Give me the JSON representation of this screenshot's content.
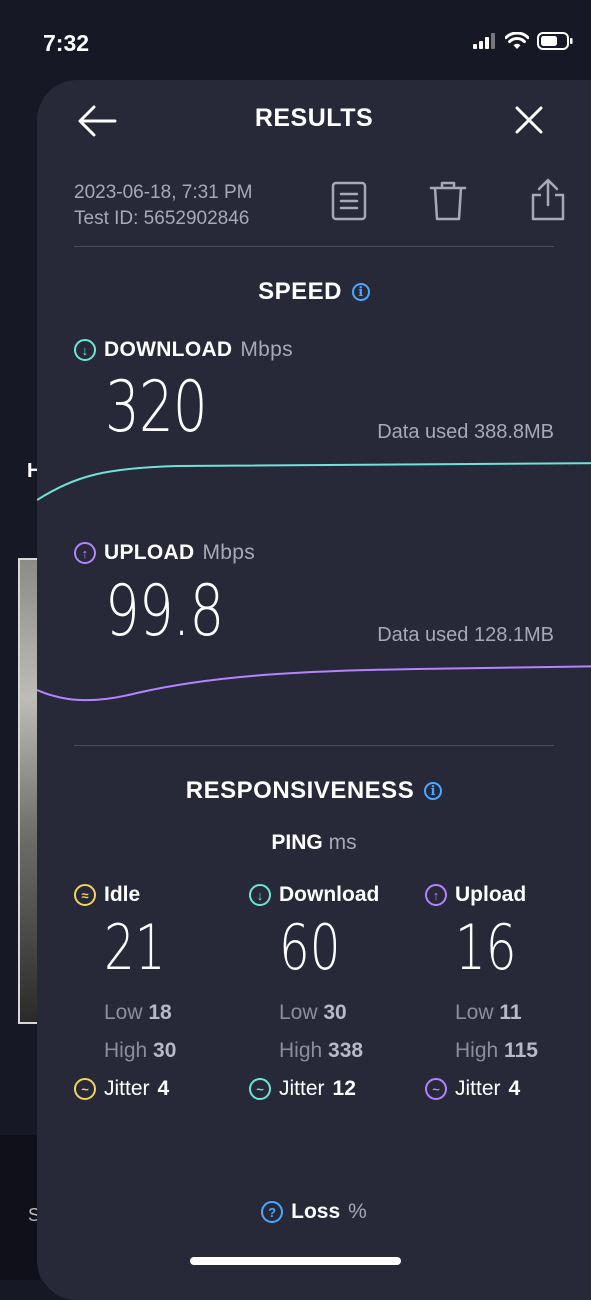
{
  "status_bar": {
    "time": "7:32"
  },
  "background": {
    "letter_top": "H",
    "letter_bottom": "S"
  },
  "header": {
    "title": "RESULTS"
  },
  "meta": {
    "date": "2023-06-18, 7:31 PM",
    "test_id": "Test ID: 5652902846"
  },
  "toolbar": {
    "icons": [
      "document-icon",
      "trash-icon",
      "share-icon"
    ]
  },
  "speed": {
    "title": "SPEED",
    "download": {
      "label": "DOWNLOAD",
      "unit": "Mbps",
      "value": "320",
      "data_used": "Data used 388.8MB",
      "color": "#6fe3d6"
    },
    "upload": {
      "label": "UPLOAD",
      "unit": "Mbps",
      "value": "99.8",
      "data_used": "Data used 128.1MB",
      "color": "#b583ff"
    }
  },
  "responsiveness": {
    "title": "RESPONSIVENESS",
    "ping_label": "PING",
    "ping_unit": "ms",
    "columns": [
      {
        "label": "Idle",
        "value": "21",
        "low_label": "Low",
        "low": "18",
        "high_label": "High",
        "high": "30",
        "jitter_label": "Jitter",
        "jitter": "4",
        "color": "#f2d35b",
        "icon": "idle-icon"
      },
      {
        "label": "Download",
        "value": "60",
        "low_label": "Low",
        "low": "30",
        "high_label": "High",
        "high": "338",
        "jitter_label": "Jitter",
        "jitter": "12",
        "color": "#6fe3d6",
        "icon": "download-icon"
      },
      {
        "label": "Upload",
        "value": "16",
        "low_label": "Low",
        "low": "11",
        "high_label": "High",
        "high": "115",
        "jitter_label": "Jitter",
        "jitter": "4",
        "color": "#b583ff",
        "icon": "upload-icon"
      }
    ]
  },
  "loss": {
    "label": "Loss",
    "unit": "%"
  }
}
